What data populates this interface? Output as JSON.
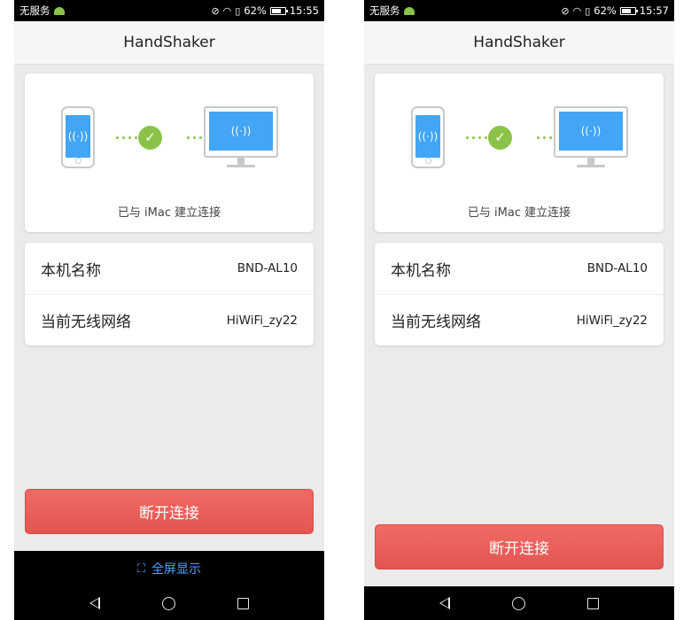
{
  "screens": [
    {
      "status_bar": {
        "carrier": "无服务",
        "battery": "62%",
        "time": "15:55"
      },
      "app_title": "HandShaker",
      "connection_text": "已与 iMac 建立连接",
      "info": [
        {
          "label": "本机名称",
          "value": "BND-AL10"
        },
        {
          "label": "当前无线网络",
          "value": "HiWiFi_zy22"
        }
      ],
      "disconnect_label": "断开连接",
      "fullscreen_label": "全屏显示"
    },
    {
      "status_bar": {
        "carrier": "无服务",
        "battery": "62%",
        "time": "15:57"
      },
      "app_title": "HandShaker",
      "connection_text": "已与 iMac 建立连接",
      "info": [
        {
          "label": "本机名称",
          "value": "BND-AL10"
        },
        {
          "label": "当前无线网络",
          "value": "HiWiFi_zy22"
        }
      ],
      "disconnect_label": "断开连接"
    }
  ],
  "icons": {
    "android": "android-icon",
    "mute": "mute-icon",
    "wifi": "wifi-icon",
    "sim": "sim-icon",
    "battery": "battery-icon",
    "phone_device": "phone-device-icon",
    "computer_device": "monitor-device-icon",
    "connected_check": "check-icon",
    "fullscreen": "fullscreen-icon",
    "nav_back": "back-icon",
    "nav_home": "home-icon",
    "nav_recent": "recent-apps-icon"
  },
  "colors": {
    "accent_green": "#8bc34a",
    "device_screen_blue": "#42a5f5",
    "disconnect_red": "#e8595a",
    "fullscreen_link_blue": "#4da3ff",
    "background_gray": "#ebebeb"
  }
}
